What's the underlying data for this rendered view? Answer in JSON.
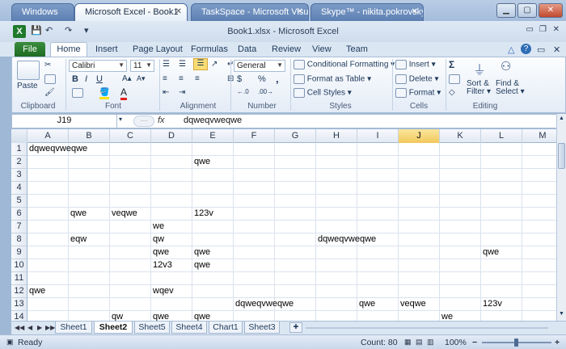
{
  "window_tabs": [
    {
      "label": "Windows",
      "active": false
    },
    {
      "label": "Microsoft Excel - Book1",
      "active": true
    },
    {
      "label": "TaskSpace - Microsoft Visu...",
      "active": false
    },
    {
      "label": "Skype™ - nikita.pokrovsky",
      "active": false
    }
  ],
  "app_title": "Book1.xlsx - Microsoft Excel",
  "ribbon_tabs": {
    "file": "File",
    "home": "Home",
    "others": [
      "Insert",
      "Page Layout",
      "Formulas",
      "Data",
      "Review",
      "View",
      "Team"
    ]
  },
  "ribbon": {
    "clipboard": {
      "paste": "Paste",
      "label": "Clipboard"
    },
    "font": {
      "name": "Calibri",
      "size": "11",
      "bold": "B",
      "italic": "I",
      "underline": "U",
      "label": "Font"
    },
    "alignment": {
      "label": "Alignment"
    },
    "number": {
      "format": "General",
      "currency": "$",
      "percent": "%",
      "comma": ",",
      "label": "Number"
    },
    "styles": {
      "conditional": "Conditional Formatting",
      "table": "Format as Table",
      "cell": "Cell Styles",
      "label": "Styles"
    },
    "cells": {
      "insert": "Insert",
      "delete": "Delete",
      "format": "Format",
      "label": "Cells"
    },
    "editing": {
      "sigma": "Σ",
      "sort_l1": "Sort &",
      "sort_l2": "Filter",
      "find_l1": "Find &",
      "find_l2": "Select",
      "label": "Editing"
    }
  },
  "formula_bar": {
    "name_box": "J19",
    "fx": "fx",
    "formula": "dqweqvweqwe"
  },
  "columns": [
    "A",
    "B",
    "C",
    "D",
    "E",
    "F",
    "G",
    "H",
    "I",
    "J",
    "K",
    "L",
    "M"
  ],
  "selected_column": "J",
  "rows": [
    "1",
    "2",
    "3",
    "4",
    "5",
    "6",
    "7",
    "8",
    "9",
    "10",
    "11",
    "12",
    "13",
    "14"
  ],
  "cells": [
    {
      "ref": "A1",
      "value": "dqweqvweqwe"
    },
    {
      "ref": "E2",
      "value": "qwe"
    },
    {
      "ref": "B6",
      "value": "qwe"
    },
    {
      "ref": "C6",
      "value": "veqwe"
    },
    {
      "ref": "E6",
      "value": "123v"
    },
    {
      "ref": "D7",
      "value": "we"
    },
    {
      "ref": "B8",
      "value": "eqw"
    },
    {
      "ref": "D8",
      "value": "qw"
    },
    {
      "ref": "H8",
      "value": "dqweqvweqwe"
    },
    {
      "ref": "D9",
      "value": "qwe"
    },
    {
      "ref": "E9",
      "value": "qwe"
    },
    {
      "ref": "L9",
      "value": "qwe"
    },
    {
      "ref": "D10",
      "value": "12v3"
    },
    {
      "ref": "E10",
      "value": "qwe"
    },
    {
      "ref": "A12",
      "value": "qwe"
    },
    {
      "ref": "D12",
      "value": "wqev"
    },
    {
      "ref": "F13",
      "value": "dqweqvweqwe"
    },
    {
      "ref": "I13",
      "value": "qwe"
    },
    {
      "ref": "J13",
      "value": "veqwe"
    },
    {
      "ref": "L13",
      "value": "123v"
    },
    {
      "ref": "C14",
      "value": "qw"
    },
    {
      "ref": "D14",
      "value": "qwe"
    },
    {
      "ref": "E14",
      "value": "qwe"
    },
    {
      "ref": "K14",
      "value": "we"
    }
  ],
  "sheet_tabs": [
    {
      "label": "Sheet1",
      "active": false
    },
    {
      "label": "Sheet2",
      "active": true
    },
    {
      "label": "Sheet5",
      "active": false
    },
    {
      "label": "Sheet4",
      "active": false
    },
    {
      "label": "Chart1",
      "active": false
    },
    {
      "label": "Sheet3",
      "active": false
    }
  ],
  "status": {
    "ready": "Ready",
    "count": "Count: 80",
    "zoom": "100%"
  },
  "colors": {
    "accent": "#1e395b",
    "file_tab": "#2a7a2e",
    "selected_header": "#f5cf6a"
  }
}
